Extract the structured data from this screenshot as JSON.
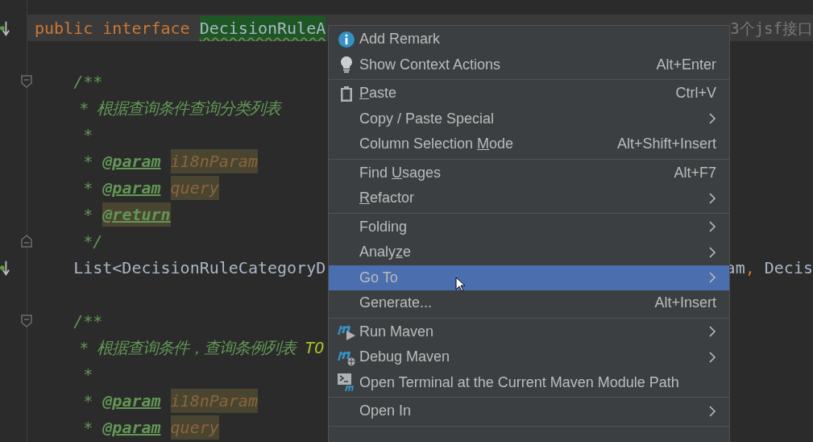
{
  "editor": {
    "lines": [
      {
        "kind": "implemented",
        "current": true,
        "tokens": [
          {
            "kind": "keyword",
            "text": "public interface "
          },
          {
            "kind": "highlight",
            "text": "DecisionRuleA"
          }
        ],
        "right": [
          {
            "kind": "hint",
            "text": "3个jsf接口"
          }
        ]
      },
      {
        "kind": "blank"
      },
      {
        "kind": "fold-start",
        "tokens": [
          {
            "kind": "comment",
            "text": "    /**"
          }
        ]
      },
      {
        "tokens": [
          {
            "kind": "comment-cjk",
            "text": "     * 根据查询条件查询分类列表"
          }
        ]
      },
      {
        "tokens": [
          {
            "kind": "comment",
            "text": "     *"
          }
        ]
      },
      {
        "tokens": [
          {
            "kind": "comment",
            "text": "     * "
          },
          {
            "kind": "tag",
            "text": "@param"
          },
          {
            "kind": "param",
            "text": "i18nParam"
          }
        ]
      },
      {
        "tokens": [
          {
            "kind": "comment",
            "text": "     * "
          },
          {
            "kind": "tag",
            "text": "@param"
          },
          {
            "kind": "param",
            "text": "query"
          }
        ]
      },
      {
        "tokens": [
          {
            "kind": "comment",
            "text": "     * "
          },
          {
            "kind": "tag-marked",
            "text": "@return"
          }
        ]
      },
      {
        "kind": "fold-end",
        "tokens": [
          {
            "kind": "comment",
            "text": "     */"
          }
        ]
      },
      {
        "kind": "implemented",
        "tokens": [
          {
            "kind": "plain",
            "text": "    List<DecisionRuleCategoryD"
          }
        ],
        "right": [
          {
            "kind": "plain",
            "text": "am"
          },
          {
            "kind": "keyword",
            "text": ","
          },
          {
            "kind": "plain",
            "text": " Decis"
          }
        ]
      },
      {
        "kind": "blank"
      },
      {
        "kind": "fold-start",
        "tokens": [
          {
            "kind": "comment",
            "text": "    /**"
          }
        ]
      },
      {
        "tokens": [
          {
            "kind": "comment-cjk",
            "text": "     * 根据查询条件，查询条例列表 "
          },
          {
            "kind": "todo",
            "text": "TO"
          }
        ]
      },
      {
        "tokens": [
          {
            "kind": "comment",
            "text": "     *"
          }
        ]
      },
      {
        "tokens": [
          {
            "kind": "comment",
            "text": "     * "
          },
          {
            "kind": "tag",
            "text": "@param"
          },
          {
            "kind": "param",
            "text": "i18nParam"
          }
        ]
      },
      {
        "tokens": [
          {
            "kind": "comment",
            "text": "     * "
          },
          {
            "kind": "tag",
            "text": "@param"
          },
          {
            "kind": "param",
            "text": "query"
          }
        ]
      }
    ]
  },
  "context_menu": {
    "groups": [
      [
        {
          "kind": "info",
          "label": {
            "before": "Add Remark"
          },
          "selected": false
        },
        {
          "kind": "bulb",
          "label": {
            "before": "Show Context Actions"
          },
          "shortcut": "Alt+Enter",
          "selected": false
        }
      ],
      [
        {
          "kind": "clipboard",
          "label": {
            "mnemonic": "P",
            "after": "aste"
          },
          "shortcut": "Ctrl+V",
          "selected": false
        },
        {
          "label": {
            "before": "Copy / Paste Special"
          },
          "submenu": true,
          "selected": false
        },
        {
          "label": {
            "before": "Column Selection ",
            "mnemonic": "M",
            "after": "ode"
          },
          "shortcut": "Alt+Shift+Insert",
          "selected": false
        }
      ],
      [
        {
          "label": {
            "before": "Find ",
            "mnemonic": "U",
            "after": "sages"
          },
          "shortcut": "Alt+F7",
          "selected": false
        },
        {
          "label": {
            "mnemonic": "R",
            "after": "efactor"
          },
          "submenu": true,
          "selected": false
        }
      ],
      [
        {
          "label": {
            "before": "Folding"
          },
          "submenu": true,
          "selected": false
        },
        {
          "label": {
            "before": "Analy",
            "mnemonic": "z",
            "after": "e"
          },
          "submenu": true,
          "selected": false
        },
        {
          "label": {
            "before": "Go To"
          },
          "submenu": true,
          "selected": true
        },
        {
          "label": {
            "before": "Generate..."
          },
          "shortcut": "Alt+Insert",
          "selected": false
        }
      ],
      [
        {
          "kind": "maven-run",
          "label": {
            "before": "Run Maven"
          },
          "submenu": true,
          "selected": false
        },
        {
          "kind": "maven-debug",
          "label": {
            "before": "Debug Maven"
          },
          "submenu": true,
          "selected": false
        },
        {
          "kind": "terminal",
          "label": {
            "before": "Open Terminal at the Current Maven Module Path"
          },
          "selected": false
        }
      ],
      [
        {
          "label": {
            "before": "Open In"
          },
          "submenu": true,
          "selected": false
        }
      ]
    ]
  }
}
